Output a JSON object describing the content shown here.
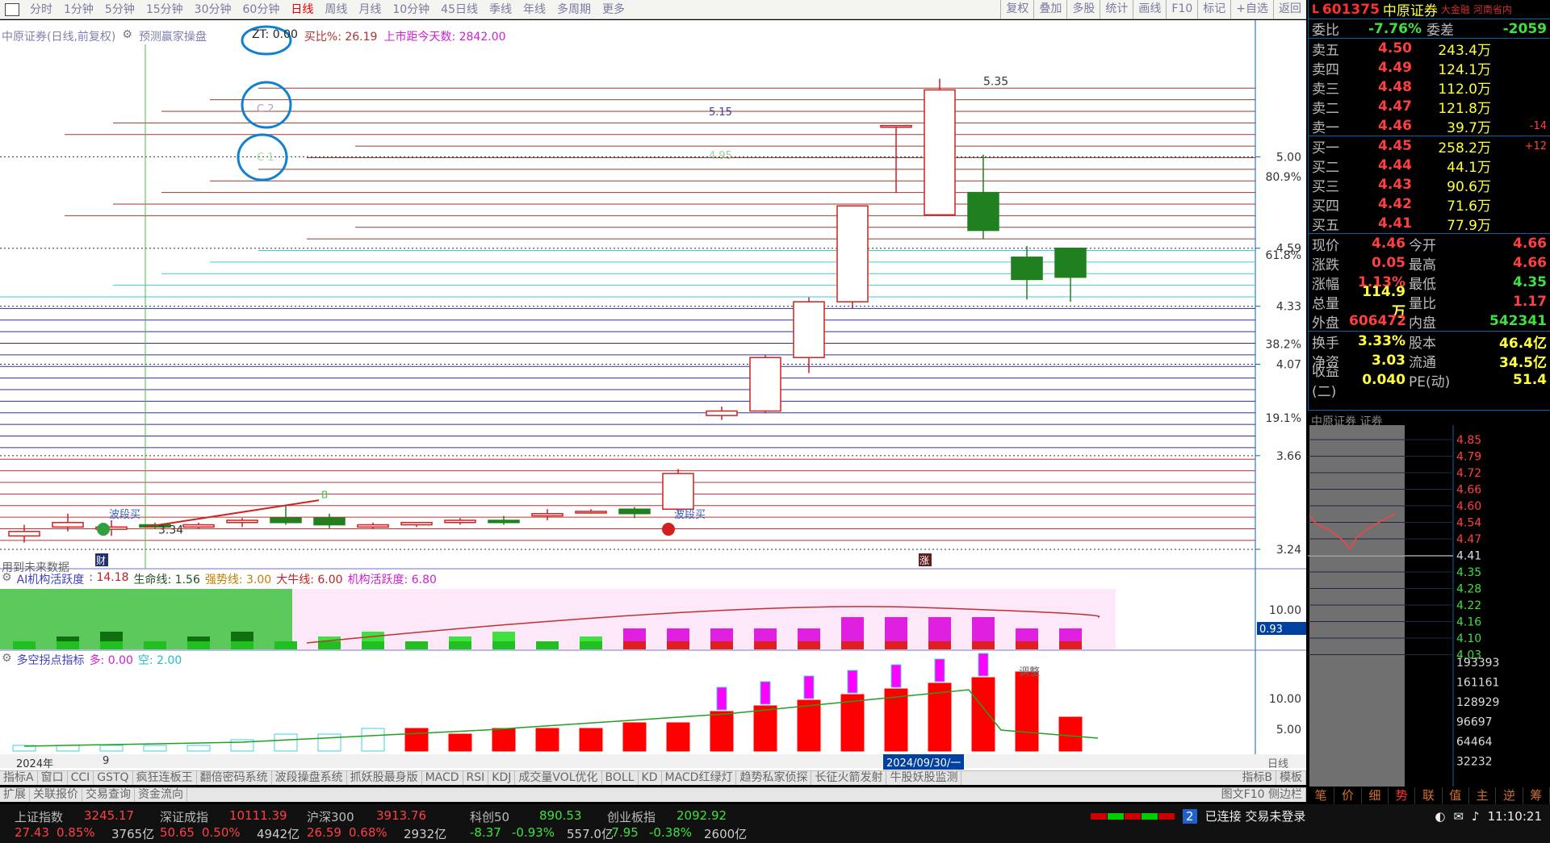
{
  "topbar": {
    "periods": [
      "分时",
      "1分钟",
      "5分钟",
      "15分钟",
      "30分钟",
      "60分钟",
      "日线",
      "周线",
      "月线",
      "10分钟",
      "45日线",
      "季线",
      "年线",
      "多周期",
      "更多"
    ],
    "active_index": 6,
    "tools": [
      "复权",
      "叠加",
      "多股",
      "统计",
      "画线",
      "F10",
      "标记",
      "+自选",
      "返回"
    ]
  },
  "main_chart": {
    "stock_title": "中原证券(日线,前复权)",
    "strategy": "预测赢家操盘",
    "zt_label": "ZT: 0.00",
    "buy_ratio": "买比%: 26.19",
    "listed_days": "上市距今天数: 2842.00",
    "future_note": "用到未来数据",
    "price_levels": [
      "5.00",
      "4.59",
      "4.33",
      "4.07",
      "3.66",
      "3.24"
    ],
    "pct_levels": [
      "80.9%",
      "61.8%",
      "38.2%",
      "19.1%"
    ],
    "high_mark": "5.35",
    "low_mark": "3.34",
    "c_labels": [
      "C 2",
      "C 1"
    ],
    "mid_labels": [
      "5.15",
      "4.95"
    ],
    "wave_labels": [
      "波段买",
      "波段买"
    ],
    "b_label": "B",
    "markers": [
      "财",
      "涨"
    ]
  },
  "chart_data": {
    "type": "candlestick",
    "ylim": [
      3.24,
      5.35
    ],
    "candles": [
      {
        "o": 3.3,
        "h": 3.35,
        "l": 3.27,
        "c": 3.32
      },
      {
        "o": 3.34,
        "h": 3.4,
        "l": 3.32,
        "c": 3.36
      },
      {
        "o": 3.33,
        "h": 3.37,
        "l": 3.3,
        "c": 3.34
      },
      {
        "o": 3.35,
        "h": 3.36,
        "l": 3.33,
        "c": 3.34
      },
      {
        "o": 3.34,
        "h": 3.36,
        "l": 3.33,
        "c": 3.35
      },
      {
        "o": 3.36,
        "h": 3.38,
        "l": 3.34,
        "c": 3.37
      },
      {
        "o": 3.38,
        "h": 3.44,
        "l": 3.35,
        "c": 3.36
      },
      {
        "o": 3.38,
        "h": 3.4,
        "l": 3.33,
        "c": 3.35
      },
      {
        "o": 3.34,
        "h": 3.36,
        "l": 3.33,
        "c": 3.35
      },
      {
        "o": 3.35,
        "h": 3.36,
        "l": 3.34,
        "c": 3.36
      },
      {
        "o": 3.36,
        "h": 3.38,
        "l": 3.35,
        "c": 3.37
      },
      {
        "o": 3.37,
        "h": 3.39,
        "l": 3.35,
        "c": 3.36
      },
      {
        "o": 3.39,
        "h": 3.42,
        "l": 3.37,
        "c": 3.4
      },
      {
        "o": 3.41,
        "h": 3.42,
        "l": 3.4,
        "c": 3.41
      },
      {
        "o": 3.42,
        "h": 3.43,
        "l": 3.38,
        "c": 3.4
      },
      {
        "o": 3.42,
        "h": 3.6,
        "l": 3.4,
        "c": 3.58
      },
      {
        "o": 3.84,
        "h": 3.88,
        "l": 3.82,
        "c": 3.86
      },
      {
        "o": 3.86,
        "h": 4.11,
        "l": 3.85,
        "c": 4.1
      },
      {
        "o": 4.1,
        "h": 4.37,
        "l": 4.03,
        "c": 4.35
      },
      {
        "o": 4.35,
        "h": 4.78,
        "l": 4.32,
        "c": 4.78
      },
      {
        "o": 5.14,
        "h": 5.14,
        "l": 4.84,
        "c": 5.14
      },
      {
        "o": 4.74,
        "h": 5.35,
        "l": 4.74,
        "c": 5.3
      },
      {
        "o": 4.84,
        "h": 5.01,
        "l": 4.63,
        "c": 4.67
      },
      {
        "o": 4.55,
        "h": 4.6,
        "l": 4.36,
        "c": 4.45
      },
      {
        "o": 4.59,
        "h": 4.59,
        "l": 4.35,
        "c": 4.46
      }
    ]
  },
  "indicator1": {
    "name": "AI机构活跃度",
    "val": ": 14.18",
    "l1": "生命线: 1.56",
    "l2": "强势线: 3.00",
    "l3": "大牛线: 6.00",
    "l4": "机构活跃度: 6.80",
    "scale": "10.00",
    "cursor_val": "0.93"
  },
  "indicator2": {
    "name": "多空拐点指标",
    "l1": "多: 0.00",
    "l2": "空: 2.00",
    "scale1": "10.00",
    "scale2": "5.00",
    "note": "调整"
  },
  "xaxis": {
    "year": "2024年",
    "month": "9",
    "date": "2024/09/30/一",
    "period": "日线"
  },
  "tabs1": [
    "指标A",
    "窗口",
    "CCI",
    "GSTQ",
    "疯狂连板王",
    "翻倍密码系统",
    "波段操盘系统",
    "抓妖股最身版",
    "MACD",
    "RSI",
    "KDJ",
    "成交量VOL优化",
    "BOLL",
    "KD",
    "MACD红绿灯",
    "趋势私家侦探",
    "长征火箭发射",
    "牛股妖股监测"
  ],
  "tabs1_right": [
    "指标B",
    "模板"
  ],
  "tabs2": [
    "扩展",
    "关联报价",
    "交易查询",
    "资金流向"
  ],
  "tabs2_right": "图文F10 侧边栏",
  "quote": {
    "code": "601375",
    "name": "中原证券",
    "tags": [
      "大金融",
      "河南省内"
    ],
    "wb_label": "委比",
    "wb": "-7.76%",
    "wc_label": "委差",
    "wc": "-2059",
    "asks": [
      {
        "label": "卖五",
        "price": "4.50",
        "vol": "243.4万",
        "d": ""
      },
      {
        "label": "卖四",
        "price": "4.49",
        "vol": "124.1万",
        "d": ""
      },
      {
        "label": "卖三",
        "price": "4.48",
        "vol": "112.0万",
        "d": ""
      },
      {
        "label": "卖二",
        "price": "4.47",
        "vol": "121.8万",
        "d": ""
      },
      {
        "label": "卖一",
        "price": "4.46",
        "vol": "39.7万",
        "d": "-14"
      }
    ],
    "bids": [
      {
        "label": "买一",
        "price": "4.45",
        "vol": "258.2万",
        "d": "+12"
      },
      {
        "label": "买二",
        "price": "4.44",
        "vol": "44.1万",
        "d": ""
      },
      {
        "label": "买三",
        "price": "4.43",
        "vol": "90.6万",
        "d": ""
      },
      {
        "label": "买四",
        "price": "4.42",
        "vol": "71.6万",
        "d": ""
      },
      {
        "label": "买五",
        "price": "4.41",
        "vol": "77.9万",
        "d": ""
      }
    ],
    "stats": [
      {
        "l1": "现价",
        "v1": "4.46",
        "l2": "今开",
        "v2": "4.66",
        "c1": "#ff4040",
        "c2": "#ff4040"
      },
      {
        "l1": "涨跌",
        "v1": "0.05",
        "l2": "最高",
        "v2": "4.66",
        "c1": "#ff4040",
        "c2": "#ff4040"
      },
      {
        "l1": "涨幅",
        "v1": "1.13%",
        "l2": "最低",
        "v2": "4.35",
        "c1": "#ff4040",
        "c2": "#40e040"
      },
      {
        "l1": "总量",
        "v1": "114.9万",
        "l2": "量比",
        "v2": "1.17",
        "c1": "#ffff40",
        "c2": "#ff4040"
      },
      {
        "l1": "外盘",
        "v1": "606472",
        "l2": "内盘",
        "v2": "542341",
        "c1": "#ff4040",
        "c2": "#40e040"
      }
    ],
    "stats2": [
      {
        "l1": "换手",
        "v1": "3.33%",
        "l2": "股本",
        "v2": "46.4亿",
        "c1": "#ffff40",
        "c2": "#ffff40"
      },
      {
        "l1": "净资",
        "v1": "3.03",
        "l2": "流通",
        "v2": "34.5亿",
        "c1": "#ffff40",
        "c2": "#ffff40"
      },
      {
        "l1": "收益(二)",
        "v1": "0.040",
        "l2": "PE(动)",
        "v2": "51.4",
        "c1": "#ffff40",
        "c2": "#ffff40"
      }
    ]
  },
  "mini_chart": {
    "title": "中原证券  证券",
    "price_ticks": [
      "4.85",
      "4.79",
      "4.72",
      "4.66",
      "4.60",
      "4.54",
      "4.47",
      "4.41",
      "4.35",
      "4.28",
      "4.22",
      "4.16",
      "4.10",
      "4.03"
    ],
    "vol_ticks": [
      "193393",
      "161161",
      "128929",
      "96697",
      "64464",
      "32232"
    ],
    "tabs": [
      "笔",
      "价",
      "细",
      "势",
      "联",
      "值",
      "主",
      "逆",
      "筹"
    ],
    "active_tab": 3
  },
  "status": {
    "indices": [
      {
        "name": "上证指数",
        "value": "3245.17",
        "chg": "27.43",
        "pct": "0.85%",
        "amt": "3765亿"
      },
      {
        "name": "深证成指",
        "value": "10111.39",
        "chg": "50.65",
        "pct": "0.50%",
        "amt": "4942亿"
      },
      {
        "name": "沪深300",
        "value": "3913.76",
        "chg": "26.59",
        "pct": "0.68%",
        "amt": "2932亿"
      },
      {
        "name": "科创50",
        "value": "890.53",
        "chg": "-8.37",
        "pct": "-0.93%",
        "amt": "557.0亿"
      },
      {
        "name": "创业板指",
        "value": "2092.92",
        "chg": "-7.95",
        "pct": "-0.38%",
        "amt": "2600亿"
      }
    ],
    "conn": "已连接 交易未登录",
    "conn_num": "2",
    "time": "11:10:21"
  }
}
